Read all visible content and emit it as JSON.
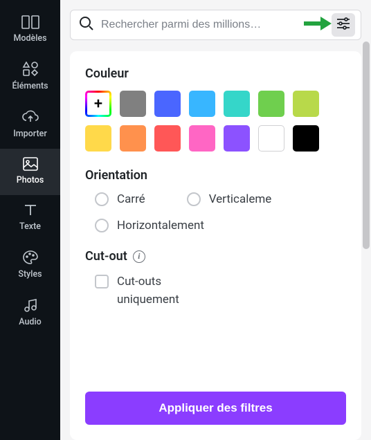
{
  "sidebar": {
    "items": [
      {
        "id": "templates",
        "label": "Modèles"
      },
      {
        "id": "elements",
        "label": "Éléments"
      },
      {
        "id": "uploads",
        "label": "Importer"
      },
      {
        "id": "photos",
        "label": "Photos"
      },
      {
        "id": "text",
        "label": "Texte"
      },
      {
        "id": "styles",
        "label": "Styles"
      },
      {
        "id": "audio",
        "label": "Audio"
      }
    ],
    "active_id": "photos"
  },
  "search": {
    "placeholder": "Rechercher parmi des millions…",
    "value": ""
  },
  "filters": {
    "color": {
      "title": "Couleur",
      "add_label": "+",
      "swatches": [
        "#808080",
        "#4a66ff",
        "#38b6ff",
        "#35d6c9",
        "#6fcf4e",
        "#b8d94a",
        "#ffd94a",
        "#ff914d",
        "#ff5757",
        "#ff66c4",
        "#8c52ff",
        "#ffffff",
        "#000000"
      ]
    },
    "orientation": {
      "title": "Orientation",
      "options": [
        {
          "id": "square",
          "label": "Carré"
        },
        {
          "id": "vertical",
          "label": "Verticaleme"
        },
        {
          "id": "horizontal",
          "label": "Horizontalement"
        }
      ]
    },
    "cutout": {
      "title": "Cut-out",
      "info_glyph": "i",
      "option_label": "Cut-outs uniquement"
    },
    "apply_label": "Appliquer des filtres"
  }
}
